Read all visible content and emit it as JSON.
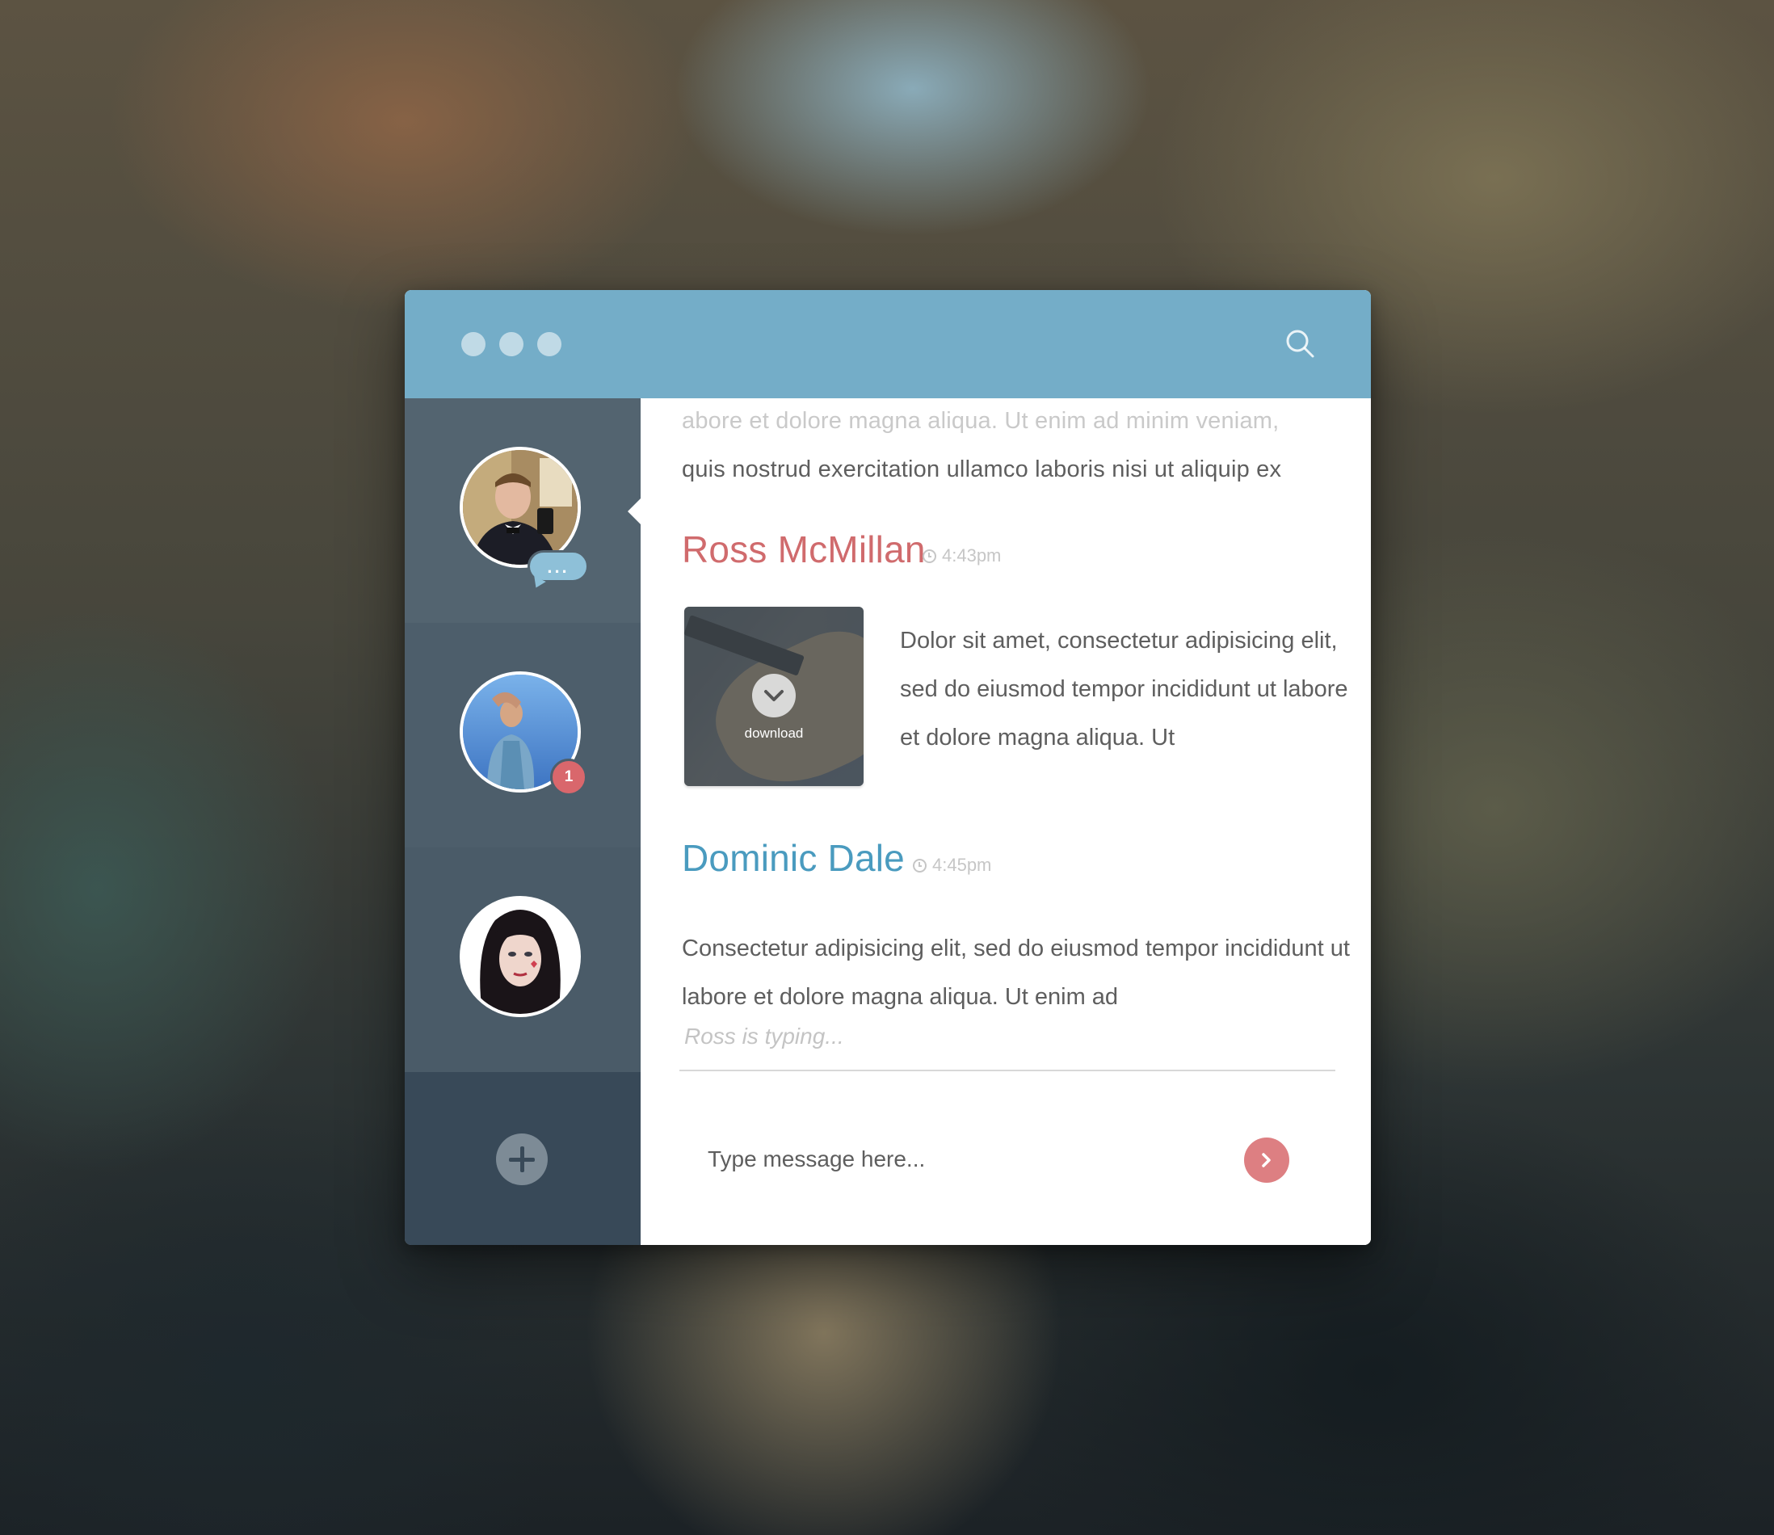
{
  "titlebar": {
    "window_controls": [
      "dot",
      "dot",
      "dot"
    ],
    "search_icon": "search-icon"
  },
  "sidebar": {
    "contacts": [
      {
        "name": "Ross McMillan",
        "status": "typing",
        "indicator": "..."
      },
      {
        "name": "contact-2",
        "unread_count": "1"
      },
      {
        "name": "contact-3"
      }
    ],
    "add_icon": "plus-icon"
  },
  "chat": {
    "previous_lines": [
      "abore et dolore magna aliqua. Ut enim ad minim veniam,",
      "quis nostrud exercitation ullamco laboris nisi ut aliquip ex"
    ],
    "messages": [
      {
        "sender": "Ross McMillan",
        "time": "4:43pm",
        "attachment_label": "download",
        "text": "Dolor sit amet, consectetur adipisicing elit, sed do eiusmod tempor incididunt ut labore et dolore magna aliqua. Ut"
      },
      {
        "sender": "Dominic Dale",
        "time": "4:45pm",
        "text": "Consectetur adipisicing elit, sed do eiusmod tempor incididunt ut labore et dolore magna aliqua. Ut enim ad"
      }
    ],
    "typing_indicator": "Ross is typing...",
    "input_placeholder": "Type message here..."
  },
  "colors": {
    "titlebar": "#74adc8",
    "sidebar": "#3a4a58",
    "ross": "#d06b6d",
    "dominic": "#4a9bbf",
    "badge": "#d9676c",
    "send": "#dd7f82"
  }
}
